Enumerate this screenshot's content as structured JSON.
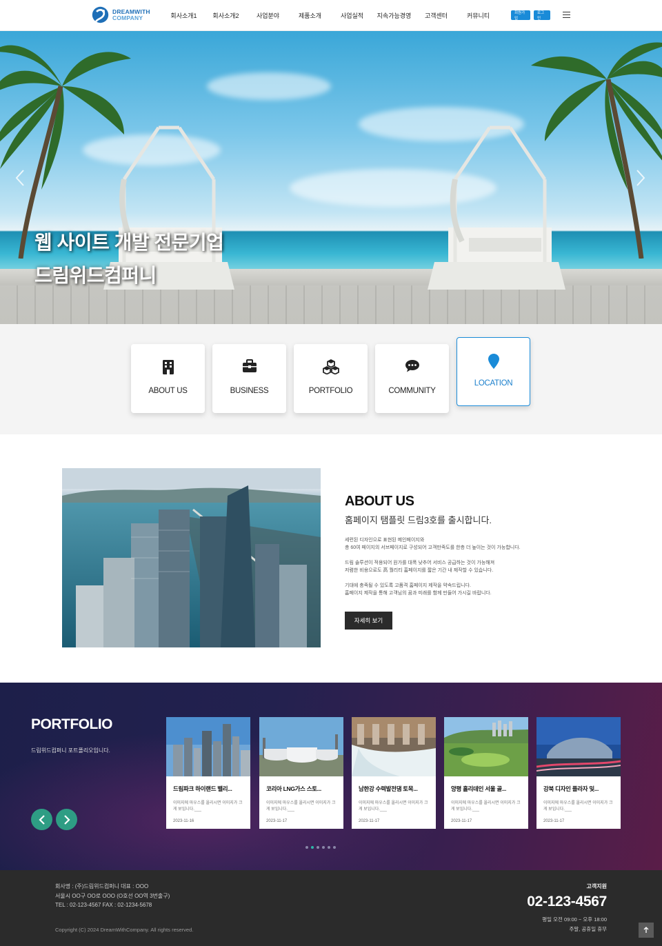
{
  "header": {
    "logo_line1": "DREAMWITH",
    "logo_line2": "COMPANY",
    "nav": [
      "회사소개1",
      "회사소개2",
      "사업분야",
      "제품소개",
      "사업실적",
      "지속가능경영",
      "고객센터",
      "커뮤니티"
    ],
    "join_label": "회원가입",
    "login_label": "로그인",
    "menu_icon": "hamburger-menu-icon"
  },
  "hero": {
    "line1": "웹 사이트 개발 전문기업",
    "line2": "드림위드컴퍼니",
    "prev_icon": "chevron-left-icon",
    "next_icon": "chevron-right-icon"
  },
  "quick_links": [
    {
      "label": "ABOUT US",
      "icon": "building-icon"
    },
    {
      "label": "BUSINESS",
      "icon": "briefcase-icon"
    },
    {
      "label": "PORTFOLIO",
      "icon": "cubes-icon"
    },
    {
      "label": "COMMUNITY",
      "icon": "chat-bubble-icon"
    },
    {
      "label": "LOCATION",
      "icon": "map-pin-icon",
      "active": true
    }
  ],
  "about": {
    "title": "ABOUT US",
    "subtitle": "홈페이지 탬플릿 드림3호를 출시합니다.",
    "paragraphs": [
      "세련된 디자인으로 표현된 메인페이지와",
      "총 60여 페이지의 서브페이지로 구성되어 고객만족도를 한층 더 높이는 것이 가능합니다.",
      "드림 솔루션이 적용되어 원가를 대폭 낮추어 서비스 공급하는 것이 가능해져",
      "저렴한 비용으로도 高 퀄리티 홈페이지를 짧은 기간 내 제작할 수 있습니다.",
      "기대에 충족될 수 있도록 고품격 홈페이지 제작을 약속드립니다.",
      "홈페이지 제작을 통해 고객님의 꿈과 미래를 함께 만들어 가시길 바랍니다."
    ],
    "button": "자세히 보기"
  },
  "portfolio": {
    "title": "PORTFOLIO",
    "description": "드림위드컴퍼니 포트폴리오입니다.",
    "items": [
      {
        "title": "드림파크 하이랜드 밸리...",
        "desc": "이미지에 마우스를 올리시면 이미지가 크게 보입니다.___",
        "date": "2023-11-16"
      },
      {
        "title": "코리아 LNG가스 스토...",
        "desc": "이미지에 마우스를 올리시면 이미지가 크게 보입니다.___",
        "date": "2023-11-17"
      },
      {
        "title": "남한강 수력발전댐 토목...",
        "desc": "이미지에 마우스를 올리시면 이미지가 크게 보입니다.___",
        "date": "2023-11-17"
      },
      {
        "title": "양평 홀리데인 서울 골...",
        "desc": "이미지에 마우스를 올리시면 이미지가 크게 보입니다.___",
        "date": "2023-11-17"
      },
      {
        "title": "강북 디자인 플라자 및...",
        "desc": "이미지에 마우스를 올리시면 이미지가 크게 보입니다.___",
        "date": "2023-11-17"
      }
    ],
    "prev_icon": "chevron-left-icon",
    "next_icon": "chevron-right-icon",
    "dot_count": 6,
    "active_dot": 1
  },
  "footer": {
    "company_line": "회사명 : (주)드림위드컴퍼니  대표 : OOO",
    "address_line": "서울시 OO구 OO로 OOO (O호선 OO역 3번출구)",
    "tel_line": "TEL : 02-123-4567  FAX : 02-1234-5678",
    "copyright": "Copyright (C) 2024 DreamWithCompany. All rights reserved.",
    "cs_label": "고객지원",
    "phone": "02-123-4567",
    "hours_weekday": "평일 오전 09:00 ~ 오후 18:00",
    "hours_holiday": "주말, 공휴일 휴무",
    "top_icon": "arrow-up-icon"
  },
  "colors": {
    "accent": "#1a8bd8",
    "portfolio_arrow": "#2e9d84",
    "footer_bg": "#2b2b2b"
  }
}
